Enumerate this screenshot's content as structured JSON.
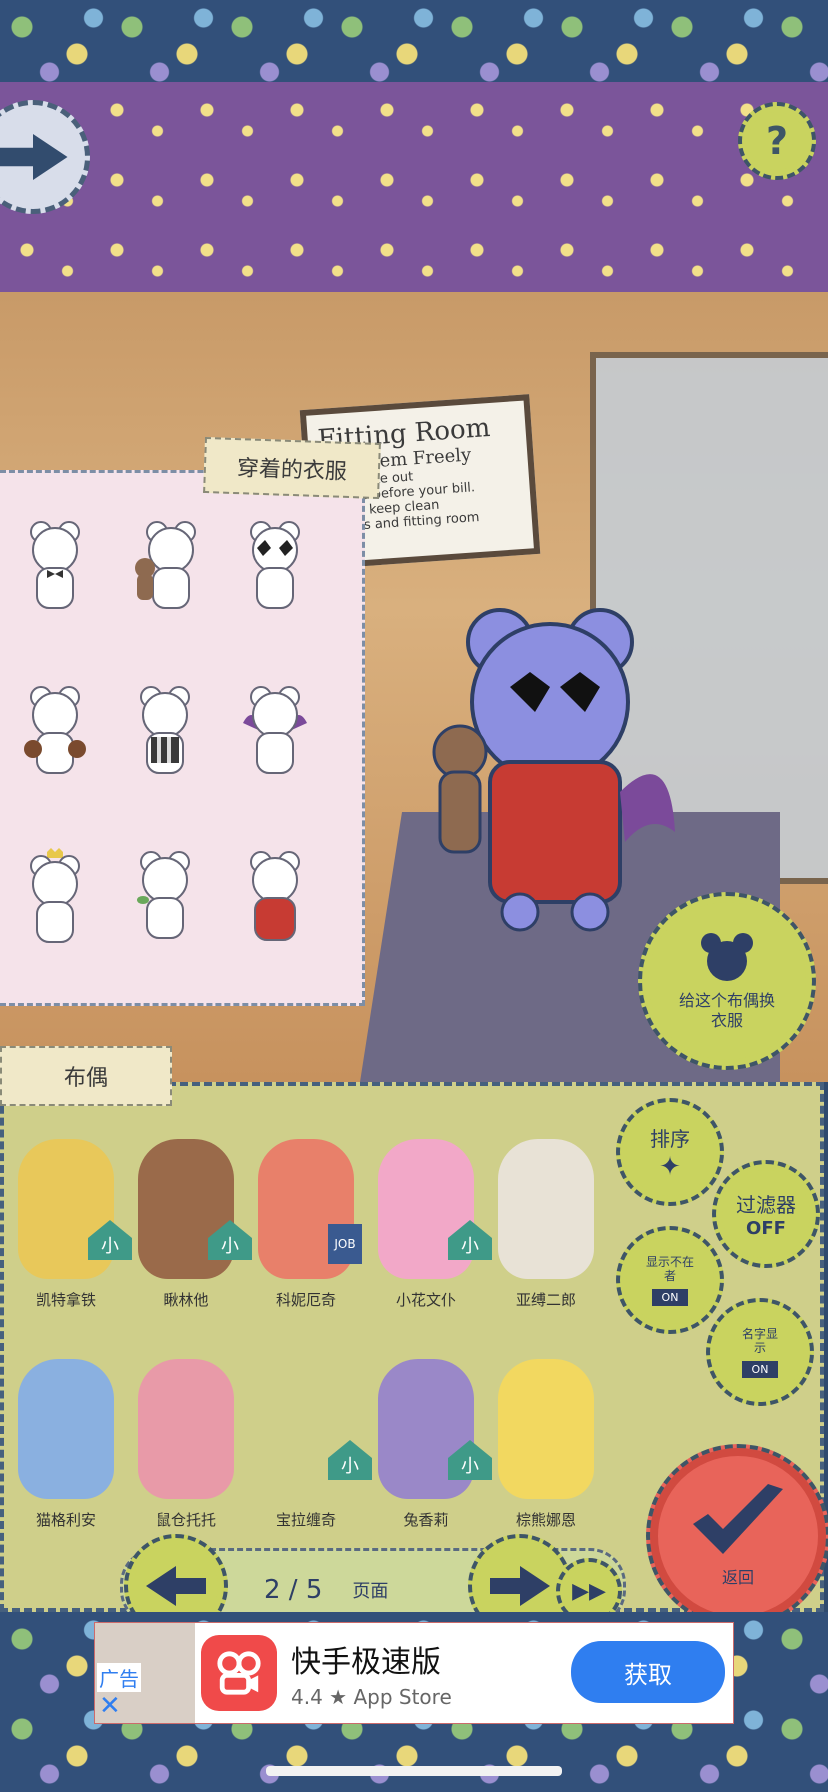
{
  "top_bar": {
    "back_icon": "right-arrow-icon",
    "help_label": "?"
  },
  "fitting_room": {
    "sign_title": "Fitting Room",
    "sign_lines": [
      "Try Them Freely",
      "Don't take out",
      "clothes before your bill.",
      "Please keep clean",
      "clothes and fitting room"
    ]
  },
  "wearing_panel": {
    "title": "穿着的衣服",
    "items": [
      "bowtie-item",
      "teddy-bear-item",
      "star-glasses-item",
      "boxing-gloves-item",
      "striped-vest-item",
      "bat-wings-item",
      "crown-item",
      "leaf-item",
      "red-jacket-item"
    ]
  },
  "change_clothes_button": {
    "label": "给这个布偶换衣服"
  },
  "dolls_panel": {
    "title": "布偶",
    "characters": [
      {
        "name": "凯特拿铁",
        "house": "小",
        "color": "#e8c85a"
      },
      {
        "name": "瞅林他",
        "house": "小",
        "color": "#9a6a4a"
      },
      {
        "name": "科妮厄奇",
        "badge": "JOB",
        "color": "#e8806a"
      },
      {
        "name": "小花文仆",
        "house": "小",
        "color": "#f2a8c8"
      },
      {
        "name": "亚缚二郎",
        "color": "#e8e2d6"
      },
      {
        "name": "猫格利安",
        "color": "#8ab0e0"
      },
      {
        "name": "鼠仓托托",
        "color": "#e89aa8"
      },
      {
        "name": "宝拉缠奇",
        "house": "小",
        "color": "#cfcf8a"
      },
      {
        "name": "兔香莉",
        "house": "小",
        "color": "#9a88c8"
      },
      {
        "name": "棕熊娜恩",
        "color": "#f2d860"
      }
    ],
    "pagination": {
      "page": "2 / 5",
      "page_label": "页面"
    }
  },
  "side_buttons": {
    "sort": "排序",
    "filter": "过滤器",
    "filter_state": "OFF",
    "show_absent": "显示不在者",
    "show_absent_state": "ON",
    "show_name": "名字显示",
    "show_name_state": "ON",
    "return": "返回"
  },
  "ad": {
    "tag": "广告",
    "app_name": "快手极速版",
    "rating": "4.4 ★ App Store",
    "cta": "获取",
    "accent": "#2f7ef0"
  }
}
